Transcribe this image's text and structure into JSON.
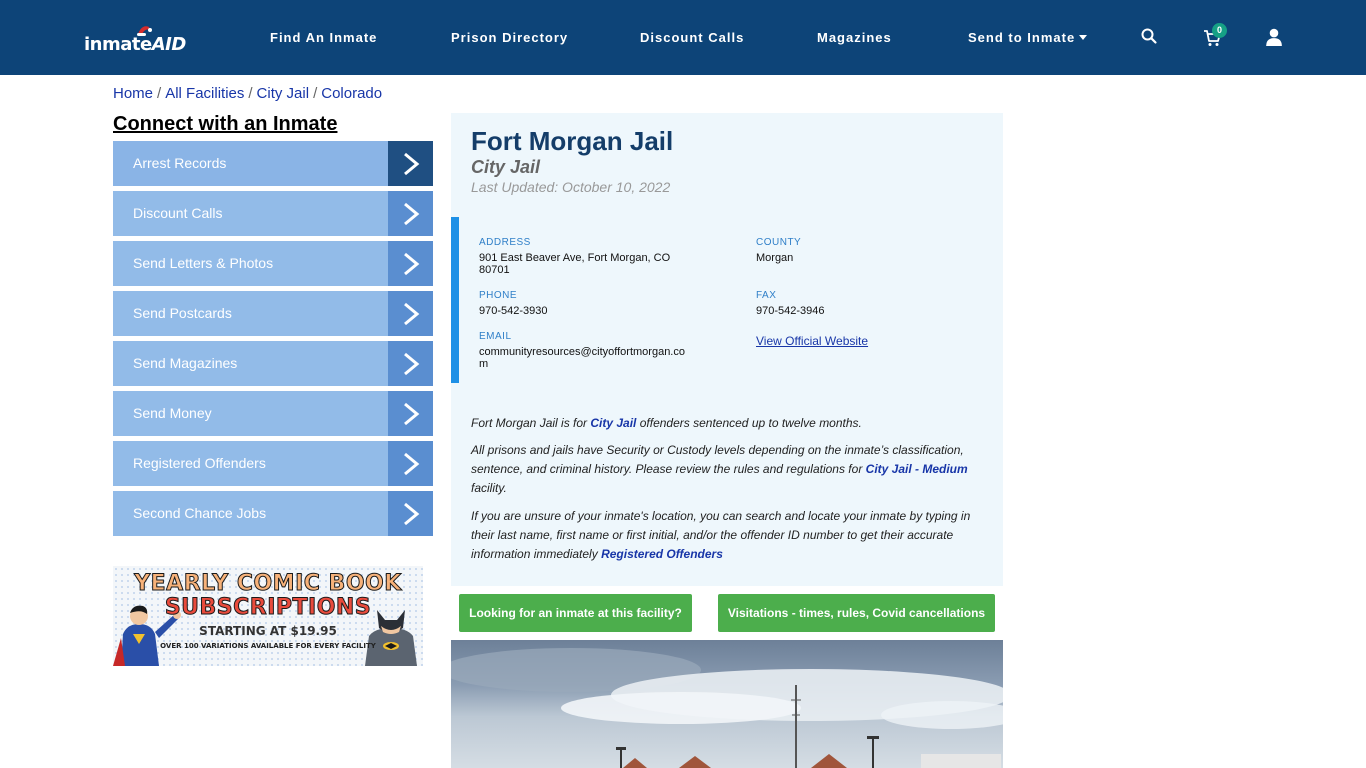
{
  "header": {
    "logo_text_1": "inmate",
    "logo_text_2": "AID",
    "nav": [
      {
        "label": "Find An Inmate"
      },
      {
        "label": "Prison Directory"
      },
      {
        "label": "Discount Calls"
      },
      {
        "label": "Magazines"
      },
      {
        "label": "Send to Inmate"
      }
    ],
    "cart_count": "0",
    "icons": [
      "search-icon",
      "cart-icon",
      "user-icon"
    ],
    "bg_color": "#0d4478"
  },
  "breadcrumb": [
    {
      "label": "Home"
    },
    {
      "label": "All Facilities"
    },
    {
      "label": "City Jail"
    },
    {
      "label": "Colorado"
    }
  ],
  "sidebar": {
    "title": "Connect with an Inmate",
    "items": [
      {
        "label": "Arrest Records"
      },
      {
        "label": "Discount Calls"
      },
      {
        "label": "Send Letters & Photos"
      },
      {
        "label": "Send Postcards"
      },
      {
        "label": "Send Magazines"
      },
      {
        "label": "Send Money"
      },
      {
        "label": "Registered Offenders"
      },
      {
        "label": "Second Chance Jobs"
      }
    ],
    "item_color": "#92bbe8",
    "arrow_color": "#5a8ed0"
  },
  "ad": {
    "line1": "YEARLY COMIC BOOK",
    "line2": "SUBSCRIPTIONS",
    "line3": "STARTING AT $19.95",
    "line4": "OVER 100 VARIATIONS AVAILABLE FOR EVERY FACILITY"
  },
  "facility": {
    "name": "Fort Morgan Jail",
    "type": "City Jail",
    "updated": "Last Updated: October 10, 2022",
    "address_label": "ADDRESS",
    "address_line1": "901 East Beaver Ave, Fort Morgan, CO",
    "address_line2": "80701",
    "county_label": "COUNTY",
    "county": "Morgan",
    "phone_label": "PHONE",
    "phone": "970-542-3930",
    "fax_label": "FAX",
    "fax": "970-542-3946",
    "email_label": "EMAIL",
    "email_line1": "communityresources@cityoffortmorgan.co",
    "email_line2": "m",
    "website_link": "View Official Website"
  },
  "description": {
    "p1_before": "Fort Morgan Jail is for ",
    "p1_link": "City Jail",
    "p1_after": " offenders sentenced up to twelve months.",
    "p2_before": "All prisons and jails have Security or Custody levels depending on the inmate’s classification, sentence, and criminal history. Please review the rules and regulations for ",
    "p2_link": "City Jail - Medium",
    "p2_after": " facility.",
    "p3_before": "If you are unsure of your inmate's location, you can search and locate your inmate by typing in their last name, first name or first initial, and/or the offender ID number to get their accurate information immediately ",
    "p3_link": "Registered Offenders"
  },
  "buttons": {
    "looking": "Looking for an inmate at this facility?",
    "visitations": "Visitations - times, rules, Covid cancellations"
  }
}
